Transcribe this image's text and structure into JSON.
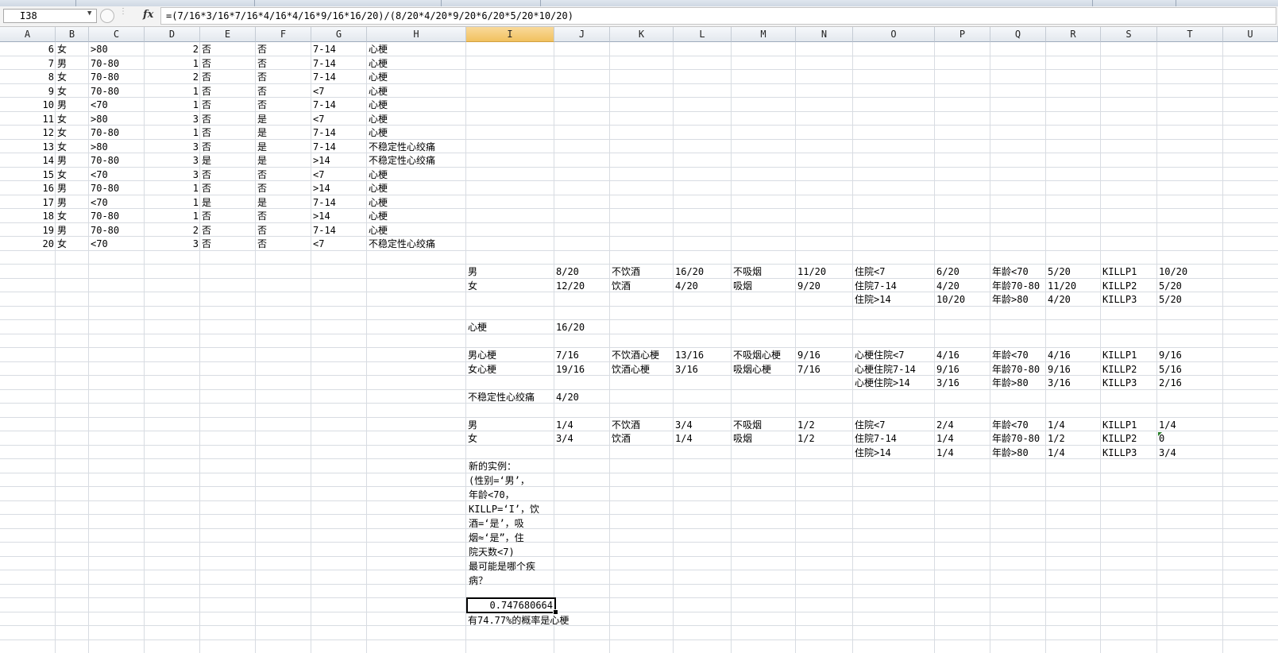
{
  "formula_bar": {
    "name_box": "I38",
    "fx_symbol": "fx",
    "formula": "=(7/16*3/16*7/16*4/16*4/16*9/16*16/20)/(8/20*4/20*9/20*6/20*5/20*10/20)"
  },
  "columns": [
    "A",
    "B",
    "C",
    "D",
    "E",
    "F",
    "G",
    "H",
    "I",
    "J",
    "K",
    "L",
    "M",
    "N",
    "O",
    "P",
    "Q",
    "R",
    "S",
    "T",
    "U"
  ],
  "active_column": "I",
  "data_rows": [
    [
      "6",
      "女",
      ">80",
      "2",
      "否",
      "否",
      "7-14",
      "心梗"
    ],
    [
      "7",
      "男",
      "70-80",
      "1",
      "否",
      "否",
      "7-14",
      "心梗"
    ],
    [
      "8",
      "女",
      "70-80",
      "2",
      "否",
      "否",
      "7-14",
      "心梗"
    ],
    [
      "9",
      "女",
      "70-80",
      "1",
      "否",
      "否",
      "<7",
      "心梗"
    ],
    [
      "10",
      "男",
      "<70",
      "1",
      "否",
      "否",
      "7-14",
      "心梗"
    ],
    [
      "11",
      "女",
      ">80",
      "3",
      "否",
      "是",
      "<7",
      "心梗"
    ],
    [
      "12",
      "女",
      "70-80",
      "1",
      "否",
      "是",
      "7-14",
      "心梗"
    ],
    [
      "13",
      "女",
      ">80",
      "3",
      "否",
      "是",
      "7-14",
      "不稳定性心绞痛"
    ],
    [
      "14",
      "男",
      "70-80",
      "3",
      "是",
      "是",
      ">14",
      "不稳定性心绞痛"
    ],
    [
      "15",
      "女",
      "<70",
      "3",
      "否",
      "否",
      "<7",
      "心梗"
    ],
    [
      "16",
      "男",
      "70-80",
      "1",
      "否",
      "否",
      ">14",
      "心梗"
    ],
    [
      "17",
      "男",
      "<70",
      "1",
      "是",
      "是",
      "7-14",
      "心梗"
    ],
    [
      "18",
      "女",
      "70-80",
      "1",
      "否",
      "否",
      ">14",
      "心梗"
    ],
    [
      "19",
      "男",
      "70-80",
      "2",
      "否",
      "否",
      "7-14",
      "心梗"
    ],
    [
      "20",
      "女",
      "<70",
      "3",
      "否",
      "否",
      "<7",
      "不稳定性心绞痛"
    ]
  ],
  "stats_rows": [
    [
      "男",
      "8/20",
      "不饮酒",
      "16/20",
      "不吸烟",
      "11/20",
      "住院<7",
      "6/20",
      "年龄<70",
      "5/20",
      "KILLP1",
      "10/20"
    ],
    [
      "女",
      "12/20",
      "饮酒",
      "4/20",
      "吸烟",
      "9/20",
      "住院7-14",
      "4/20",
      "年龄70-80",
      "11/20",
      "KILLP2",
      "5/20"
    ],
    [
      "",
      "",
      "",
      "",
      "",
      "",
      "住院>14",
      "10/20",
      "年龄>80",
      "4/20",
      "KILLP3",
      "5/20"
    ],
    [
      "",
      "",
      "",
      "",
      "",
      "",
      "",
      "",
      "",
      "",
      "",
      ""
    ],
    [
      "心梗",
      "16/20",
      "",
      "",
      "",
      "",
      "",
      "",
      "",
      "",
      "",
      ""
    ],
    [
      "",
      "",
      "",
      "",
      "",
      "",
      "",
      "",
      "",
      "",
      "",
      ""
    ],
    [
      "男心梗",
      "7/16",
      "不饮酒心梗",
      "13/16",
      "不吸烟心梗",
      "9/16",
      "心梗住院<7",
      "4/16",
      "年龄<70",
      "4/16",
      "KILLP1",
      "9/16"
    ],
    [
      "女心梗",
      "19/16",
      "饮酒心梗",
      "3/16",
      "吸烟心梗",
      "7/16",
      "心梗住院7-14",
      "9/16",
      "年龄70-80",
      "9/16",
      "KILLP2",
      "5/16"
    ],
    [
      "",
      "",
      "",
      "",
      "",
      "",
      "心梗住院>14",
      "3/16",
      "年龄>80",
      "3/16",
      "KILLP3",
      "2/16"
    ],
    [
      "不稳定性心绞痛",
      "4/20",
      "",
      "",
      "",
      "",
      "",
      "",
      "",
      "",
      "",
      ""
    ],
    [
      "",
      "",
      "",
      "",
      "",
      "",
      "",
      "",
      "",
      "",
      "",
      ""
    ],
    [
      "男",
      "1/4",
      "不饮酒",
      "3/4",
      "不吸烟",
      "1/2",
      "住院<7",
      "2/4",
      "年龄<70",
      "1/4",
      "KILLP1",
      "1/4"
    ],
    [
      "女",
      "3/4",
      "饮酒",
      "1/4",
      "吸烟",
      "1/2",
      "住院7-14",
      "1/4",
      "年龄70-80",
      "1/2",
      "KILLP2",
      "0"
    ],
    [
      "",
      "",
      "",
      "",
      "",
      "",
      "住院>14",
      "1/4",
      "年龄>80",
      "1/4",
      "KILLP3",
      "3/4"
    ]
  ],
  "question_text": "新的实例：\n(性别=‘男’，\n年龄<70，\nKILLP=‘I’，饮\n酒=‘是’，吸\n烟≈‘是”，住\n院天数<7)\n最可能是哪个疾\n病？",
  "result_value": "0.747680664",
  "conclusion": "有74.77%的概率是心梗"
}
